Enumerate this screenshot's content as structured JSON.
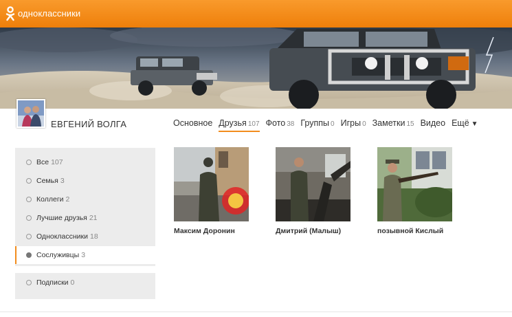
{
  "header": {
    "logo_text": "одноклассники"
  },
  "profile": {
    "name": "ЕВГЕНИЙ ВОЛГА"
  },
  "nav": [
    {
      "label": "Основное",
      "count": ""
    },
    {
      "label": "Друзья",
      "count": "107"
    },
    {
      "label": "Фото",
      "count": "38"
    },
    {
      "label": "Группы",
      "count": "0"
    },
    {
      "label": "Игры",
      "count": "0"
    },
    {
      "label": "Заметки",
      "count": "15"
    },
    {
      "label": "Видео",
      "count": ""
    },
    {
      "label": "Ещё",
      "count": ""
    }
  ],
  "sidebar": {
    "items": [
      {
        "label": "Все",
        "count": "107"
      },
      {
        "label": "Семья",
        "count": "3"
      },
      {
        "label": "Коллеги",
        "count": "2"
      },
      {
        "label": "Лучшие друзья",
        "count": "21"
      },
      {
        "label": "Одноклассники",
        "count": "18"
      },
      {
        "label": "Сослуживцы",
        "count": "3"
      },
      {
        "label": "Подписки",
        "count": "0"
      }
    ]
  },
  "friends": [
    {
      "name": "Максим Доронин"
    },
    {
      "name": "Дмитрий (Малыш)"
    },
    {
      "name": "позывной Кислый"
    }
  ],
  "colors": {
    "accent": "#f28c1d",
    "topbar": "#f28c1d",
    "sidebar_bg": "#ececec"
  }
}
